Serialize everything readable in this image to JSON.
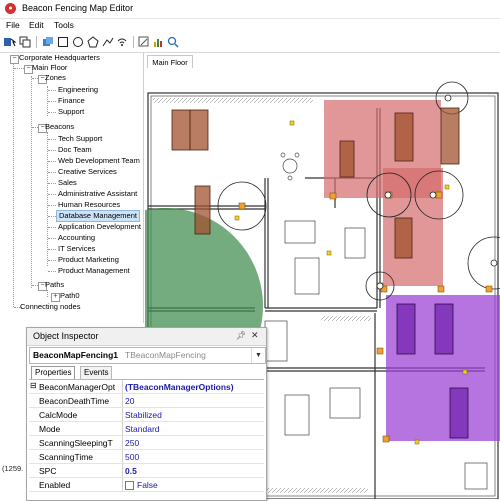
{
  "window": {
    "title": "Beacon Fencing Map Editor",
    "app_icon": "app-logo-icon"
  },
  "menu": [
    "File",
    "Edit",
    "Tools"
  ],
  "toolbar": {
    "buttons": [
      "select-tool-icon",
      "copy-icon",
      "rectangle-tool-icon",
      "circle-tool-icon",
      "polygon-tool-icon",
      "path-tool-icon",
      "node-tool-icon",
      "beacon-signal-icon",
      "edit-map-icon",
      "chart-icon",
      "zoom-icon"
    ]
  },
  "tree": {
    "root": "Corporate Headquarters",
    "floor": "Main Floor",
    "zones_label": "Zones",
    "zones": [
      "Engineering",
      "Finance",
      "Support"
    ],
    "beacons_label": "Beacons",
    "beacons": [
      "Tech Support",
      "Doc Team",
      "Web Development Team",
      "Creative Services",
      "Sales",
      "Administrative Assistant",
      "Human Resources",
      "Database Management",
      "Application Development",
      "Accounting",
      "IT Services",
      "Product Marketing",
      "Product Management"
    ],
    "selected": "Database Management",
    "paths_label": "Paths",
    "paths": [
      "Path0"
    ],
    "connecting_nodes": "Connecting nodes"
  },
  "map": {
    "tab_label": "Main Floor",
    "coordinate_readout": "(1259."
  },
  "colors": {
    "zone_red": "#d46b6b",
    "zone_green": "#3f8a4e",
    "zone_purple": "#9a3fd6",
    "desk_orange": "#a0522d",
    "node_orange": "#f0a030",
    "selection_blue": "#cde3f7"
  },
  "inspector": {
    "title": "Object Inspector",
    "pin_icon": "pin-icon",
    "close_icon": "close-icon",
    "object_name": "BeaconMapFencing1",
    "object_class": "TBeaconMapFencing",
    "tabs": [
      "Properties",
      "Events"
    ],
    "rows": [
      {
        "name": "BeaconManagerOpt",
        "value": "(TBeaconManagerOptions)",
        "expander": "⊟",
        "bold": true
      },
      {
        "name": "BeaconDeathTime",
        "value": "20"
      },
      {
        "name": "CalcMode",
        "value": "Stabilized"
      },
      {
        "name": "Mode",
        "value": "Standard"
      },
      {
        "name": "ScanningSleepingT",
        "value": "250"
      },
      {
        "name": "ScanningTime",
        "value": "500"
      },
      {
        "name": "SPC",
        "value": "0.5",
        "bold": true
      },
      {
        "name": "Enabled",
        "value": "False"
      }
    ]
  }
}
